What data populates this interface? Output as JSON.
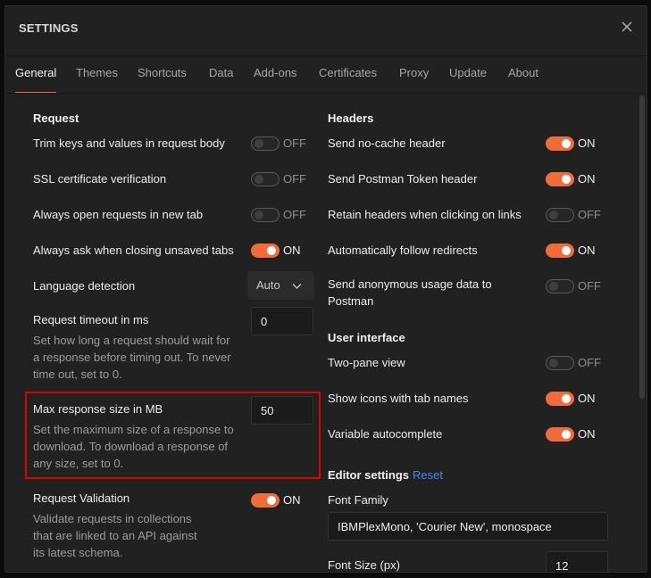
{
  "modal": {
    "title": "SETTINGS"
  },
  "tabs": [
    {
      "label": "General"
    },
    {
      "label": "Themes"
    },
    {
      "label": "Shortcuts"
    },
    {
      "label": "Data"
    },
    {
      "label": "Add-ons"
    },
    {
      "label": "Certificates"
    },
    {
      "label": "Proxy"
    },
    {
      "label": "Update"
    },
    {
      "label": "About"
    }
  ],
  "colors": {
    "accent": "#f26b3a",
    "highlight_border": "#e00000",
    "link": "#3d8bf0"
  },
  "request": {
    "title": "Request",
    "trim_keys": {
      "label": "Trim keys and values in request body",
      "state": "OFF"
    },
    "ssl": {
      "label": "SSL certificate verification",
      "state": "OFF"
    },
    "open_new_tab": {
      "label": "Always open requests in new tab",
      "state": "OFF"
    },
    "ask_closing": {
      "label": "Always ask when closing unsaved tabs",
      "state": "ON"
    },
    "language_detection": {
      "label": "Language detection",
      "value": "Auto"
    },
    "timeout": {
      "label": "Request timeout in ms",
      "description": "Set how long a request should wait for a response before timing out. To never time out, set to 0.",
      "value": "0"
    },
    "max_response": {
      "label": "Max response size in MB",
      "description": "Set the maximum size of a response to download. To download a response of any size, set to 0.",
      "value": "50"
    },
    "validation": {
      "label": "Request Validation",
      "description": "Validate requests in collections that are linked to an API against its latest schema.",
      "state": "ON"
    }
  },
  "headers": {
    "title": "Headers",
    "no_cache": {
      "label": "Send no-cache header",
      "state": "ON"
    },
    "postman_token": {
      "label": "Send Postman Token header",
      "state": "ON"
    },
    "retain_headers": {
      "label": "Retain headers when clicking on links",
      "state": "OFF"
    },
    "follow_redirects": {
      "label": "Automatically follow redirects",
      "state": "ON"
    },
    "anonymous_usage": {
      "label": "Send anonymous usage data to Postman",
      "state": "OFF"
    }
  },
  "user_interface": {
    "title": "User interface",
    "two_pane": {
      "label": "Two-pane view",
      "state": "OFF"
    },
    "tab_icons": {
      "label": "Show icons with tab names",
      "state": "ON"
    },
    "autocomplete": {
      "label": "Variable autocomplete",
      "state": "ON"
    }
  },
  "editor": {
    "title": "Editor settings",
    "reset_label": "Reset",
    "font_family": {
      "label": "Font Family",
      "value": "IBMPlexMono, 'Courier New', monospace"
    },
    "font_size": {
      "label": "Font Size (px)",
      "value": "12"
    }
  },
  "icons": {
    "close": "close-icon",
    "chevron": "chevron-down-icon"
  }
}
